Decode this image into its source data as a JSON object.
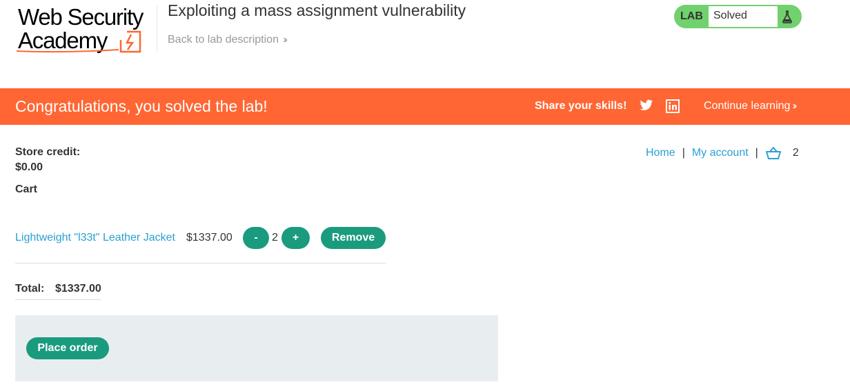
{
  "header": {
    "logo_line1": "Web Security",
    "logo_line2": "Academy",
    "lab_title": "Exploiting a mass assignment vulnerability",
    "back_link": "Back to lab description",
    "lab_status": {
      "label": "LAB",
      "state": "Solved"
    }
  },
  "banner": {
    "message": "Congratulations, you solved the lab!",
    "share_text": "Share your skills!",
    "continue_link": "Continue learning",
    "icons": [
      "twitter-icon",
      "linkedin-icon"
    ]
  },
  "account": {
    "credit_label": "Store credit:",
    "credit_value": "$0.00"
  },
  "nav": {
    "home": "Home",
    "my_account": "My account",
    "separator": "|",
    "cart_count": "2"
  },
  "cart": {
    "heading": "Cart",
    "items": [
      {
        "name": "Lightweight \"l33t\" Leather Jacket",
        "price": "$1337.00",
        "quantity": "2",
        "minus_label": "-",
        "plus_label": "+",
        "remove_label": "Remove"
      }
    ],
    "total_label": "Total:",
    "total_value": "$1337.00",
    "place_order_label": "Place order"
  },
  "colors": {
    "banner": "#ff6633",
    "link": "#29a0d1",
    "button": "#1a9b7e",
    "lab_solved": "#70d16d",
    "checkout_bg": "#e8eef0"
  }
}
